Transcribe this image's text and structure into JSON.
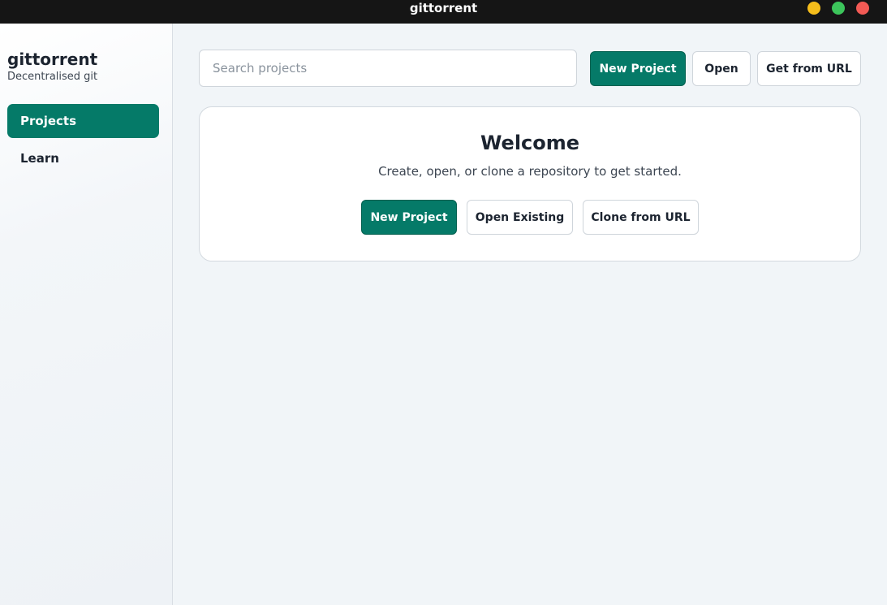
{
  "window": {
    "title": "gittorrent",
    "controls": {
      "minimize_color": "#f5bd1b",
      "maximize_color": "#3cc55b",
      "close_color": "#f25a55"
    }
  },
  "sidebar": {
    "brand": "gittorrent",
    "tagline": "Decentralised git",
    "items": [
      {
        "label": "Projects",
        "active": true
      },
      {
        "label": "Learn",
        "active": false
      }
    ]
  },
  "toolbar": {
    "search_placeholder": "Search projects",
    "search_value": "",
    "new_project_label": "New Project",
    "open_label": "Open",
    "get_from_url_label": "Get from URL"
  },
  "welcome": {
    "title": "Welcome",
    "subtitle": "Create, open, or clone a repository to get started.",
    "new_project_label": "New Project",
    "open_existing_label": "Open Existing",
    "clone_label": "Clone from URL"
  },
  "colors": {
    "accent": "#057a68",
    "background": "#f1f5f8",
    "titlebar": "#151515"
  }
}
